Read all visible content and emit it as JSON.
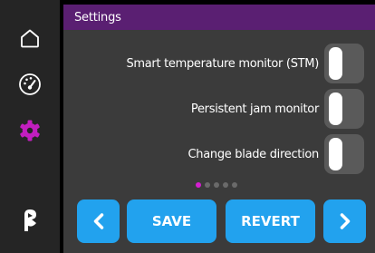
{
  "header": {
    "title": "Settings"
  },
  "sidebar": {
    "items": [
      {
        "name": "home",
        "icon": "home-icon",
        "active": false
      },
      {
        "name": "dashboard",
        "icon": "gauge-icon",
        "active": false
      },
      {
        "name": "settings",
        "icon": "gear-icon",
        "active": true
      },
      {
        "name": "brand",
        "icon": "logo-icon",
        "active": false
      }
    ]
  },
  "settings": [
    {
      "label": "Smart temperature monitor (STM)",
      "enabled": false
    },
    {
      "label": "Persistent jam monitor",
      "enabled": false
    },
    {
      "label": "Change blade direction",
      "enabled": false
    }
  ],
  "pagination": {
    "total_pages": 5,
    "current_page": 1
  },
  "footer": {
    "prev_icon": "chevron-left-icon",
    "save_label": "SAVE",
    "revert_label": "REVERT",
    "next_icon": "chevron-right-icon"
  },
  "colors": {
    "accent_purple": "#5a1f72",
    "active_icon": "#c21ebf",
    "button_blue": "#22a2ee",
    "page_dot_active": "#d51fd1"
  }
}
